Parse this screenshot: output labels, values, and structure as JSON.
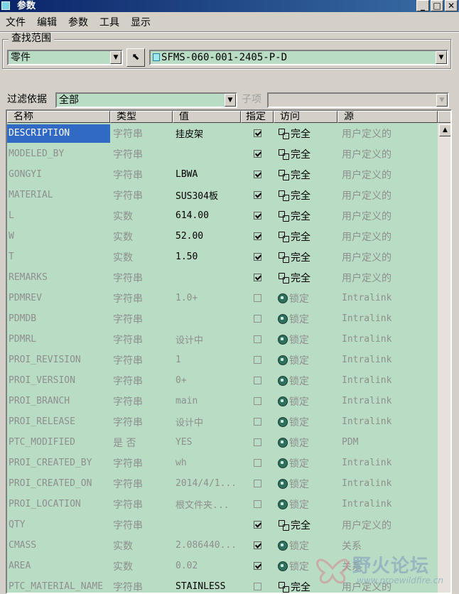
{
  "window": {
    "title": "参数",
    "minimize": "_",
    "maximize": "□",
    "close": "✕"
  },
  "menu": [
    "文件",
    "编辑",
    "参数",
    "工具",
    "显示"
  ],
  "search_scope": {
    "legend": "查找范围",
    "type_value": "零件",
    "model_value": "SFMS-060-001-2405-P-D"
  },
  "filter": {
    "label": "过滤依据",
    "value": "全部",
    "sub_label": "子项",
    "sub_value": ""
  },
  "columns": [
    "名称",
    "类型",
    "值",
    "指定",
    "访问",
    "源"
  ],
  "rows": [
    {
      "name": "DESCRIPTION",
      "type": "字符串",
      "value": "挂皮架",
      "set": true,
      "access": "完全",
      "source": "用户定义的",
      "selected": true
    },
    {
      "name": "MODELED_BY",
      "type": "字符串",
      "value": "",
      "set": true,
      "access": "完全",
      "source": "用户定义的"
    },
    {
      "name": "GONGYI",
      "type": "字符串",
      "value": "LBWA",
      "set": true,
      "access": "完全",
      "source": "用户定义的"
    },
    {
      "name": "MATERIAL",
      "type": "字符串",
      "value": "SUS304板",
      "set": true,
      "access": "完全",
      "source": "用户定义的"
    },
    {
      "name": "L",
      "type": "实数",
      "value": "614.00",
      "set": true,
      "access": "完全",
      "source": "用户定义的"
    },
    {
      "name": "W",
      "type": "实数",
      "value": "52.00",
      "set": true,
      "access": "完全",
      "source": "用户定义的"
    },
    {
      "name": "T",
      "type": "实数",
      "value": "1.50",
      "set": true,
      "access": "完全",
      "source": "用户定义的"
    },
    {
      "name": "REMARKS",
      "type": "字符串",
      "value": "",
      "set": true,
      "access": "完全",
      "source": "用户定义的"
    },
    {
      "name": "PDMREV",
      "type": "字符串",
      "value": "1.0+",
      "set": false,
      "access": "锁定",
      "source": "Intralink"
    },
    {
      "name": "PDMDB",
      "type": "字符串",
      "value": "",
      "set": false,
      "access": "锁定",
      "source": "Intralink"
    },
    {
      "name": "PDMRL",
      "type": "字符串",
      "value": "设计中",
      "set": false,
      "access": "锁定",
      "source": "Intralink"
    },
    {
      "name": "PROI_REVISION",
      "type": "字符串",
      "value": "1",
      "set": false,
      "access": "锁定",
      "source": "Intralink"
    },
    {
      "name": "PROI_VERSION",
      "type": "字符串",
      "value": "0+",
      "set": false,
      "access": "锁定",
      "source": "Intralink"
    },
    {
      "name": "PROI_BRANCH",
      "type": "字符串",
      "value": "main",
      "set": false,
      "access": "锁定",
      "source": "Intralink"
    },
    {
      "name": "PROI_RELEASE",
      "type": "字符串",
      "value": "设计中",
      "set": false,
      "access": "锁定",
      "source": "Intralink"
    },
    {
      "name": "PTC_MODIFIED",
      "type": "是 否",
      "value": "YES",
      "set": false,
      "access": "锁定",
      "source": "PDM"
    },
    {
      "name": "PROI_CREATED_BY",
      "type": "字符串",
      "value": "wh",
      "set": false,
      "access": "锁定",
      "source": "Intralink"
    },
    {
      "name": "PROI_CREATED_ON",
      "type": "字符串",
      "value": "2014/4/1...",
      "set": false,
      "access": "锁定",
      "source": "Intralink"
    },
    {
      "name": "PROI_LOCATION",
      "type": "字符串",
      "value": "根文件夹...",
      "set": false,
      "access": "锁定",
      "source": "Intralink"
    },
    {
      "name": "QTY",
      "type": "字符串",
      "value": "",
      "set": true,
      "access": "完全",
      "source": "用户定义的"
    },
    {
      "name": "CMASS",
      "type": "实数",
      "value": "2.086440...",
      "set": true,
      "access": "锁定",
      "source": "关系"
    },
    {
      "name": "AREA",
      "type": "实数",
      "value": "0.02",
      "set": true,
      "access": "锁定",
      "source": "关系"
    },
    {
      "name": "PTC_MATERIAL_NAME",
      "type": "字符串",
      "value": "STAINLESS",
      "set": false,
      "access": "完全",
      "source": "用户定义的"
    }
  ],
  "watermark": {
    "text": "野火论坛",
    "url": "www.proewildfire.cn"
  }
}
